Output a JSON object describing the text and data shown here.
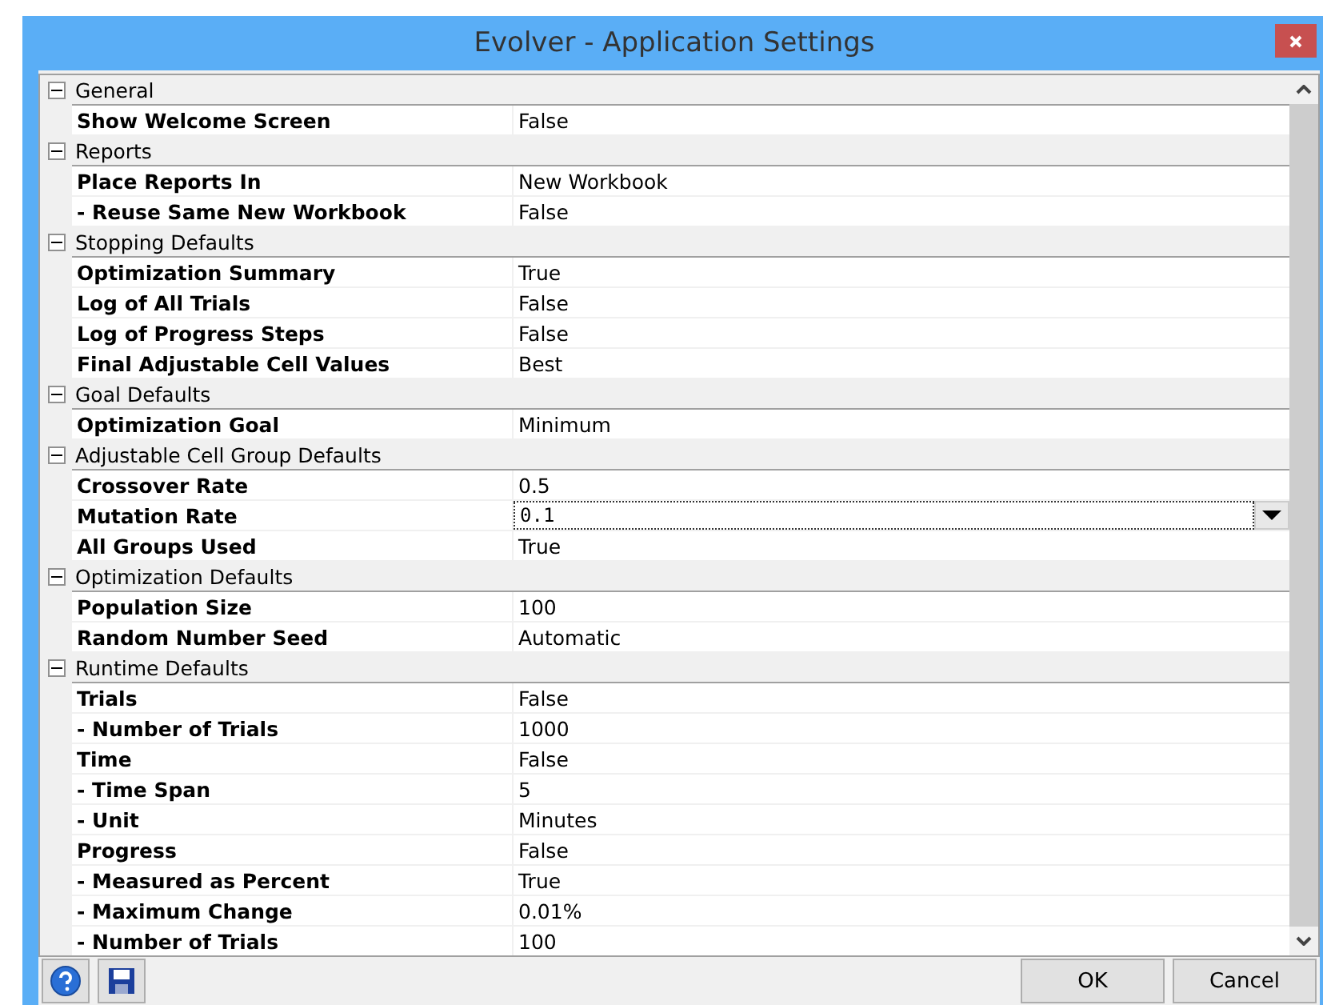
{
  "window": {
    "title": "Evolver - Application Settings"
  },
  "sections": [
    {
      "title": "General",
      "expanded": true,
      "properties": [
        {
          "name": "Show Welcome Screen",
          "value": "False",
          "selected": false
        }
      ]
    },
    {
      "title": "Reports",
      "expanded": true,
      "properties": [
        {
          "name": "Place Reports In",
          "value": "New Workbook",
          "selected": false
        },
        {
          "name": "- Reuse Same New Workbook",
          "value": "False",
          "selected": false
        }
      ]
    },
    {
      "title": "Stopping Defaults",
      "expanded": true,
      "properties": [
        {
          "name": "Optimization Summary",
          "value": "True",
          "selected": false
        },
        {
          "name": "Log of All Trials",
          "value": "False",
          "selected": false
        },
        {
          "name": "Log of Progress Steps",
          "value": "False",
          "selected": false
        },
        {
          "name": "Final Adjustable Cell Values",
          "value": "Best",
          "selected": false
        }
      ]
    },
    {
      "title": "Goal Defaults",
      "expanded": true,
      "properties": [
        {
          "name": "Optimization Goal",
          "value": "Minimum",
          "selected": false
        }
      ]
    },
    {
      "title": "Adjustable Cell Group Defaults",
      "expanded": true,
      "properties": [
        {
          "name": "Crossover Rate",
          "value": "0.5",
          "selected": false
        },
        {
          "name": "Mutation Rate",
          "value": "0.1",
          "selected": true
        },
        {
          "name": "All Groups Used",
          "value": "True",
          "selected": false
        }
      ]
    },
    {
      "title": "Optimization Defaults",
      "expanded": true,
      "properties": [
        {
          "name": "Population Size",
          "value": "100",
          "selected": false
        },
        {
          "name": "Random Number Seed",
          "value": "Automatic",
          "selected": false
        }
      ]
    },
    {
      "title": "Runtime Defaults",
      "expanded": true,
      "properties": [
        {
          "name": "Trials",
          "value": "False",
          "selected": false
        },
        {
          "name": "- Number of Trials",
          "value": "1000",
          "selected": false
        },
        {
          "name": "Time",
          "value": "False",
          "selected": false
        },
        {
          "name": "- Time Span",
          "value": "5",
          "selected": false
        },
        {
          "name": "- Unit",
          "value": "Minutes",
          "selected": false
        },
        {
          "name": "Progress",
          "value": "False",
          "selected": false
        },
        {
          "name": "- Measured as Percent",
          "value": "True",
          "selected": false
        },
        {
          "name": "- Maximum Change",
          "value": "0.01%",
          "selected": false
        },
        {
          "name": "- Number of Trials",
          "value": "100",
          "selected": false
        }
      ]
    }
  ],
  "buttons": [
    {
      "label": "OK"
    },
    {
      "label": "Cancel"
    }
  ]
}
